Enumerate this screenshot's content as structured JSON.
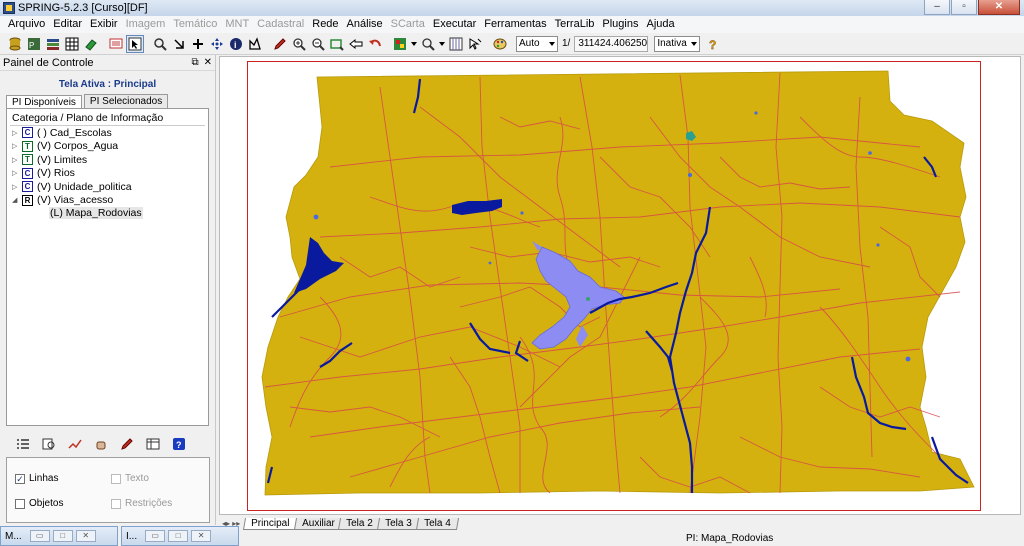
{
  "window": {
    "title": "SPRING-5.2.3 [Curso][DF]",
    "minimize": "–",
    "restore": "▫",
    "close": "✕"
  },
  "menu": [
    {
      "label": "Arquivo",
      "enabled": true
    },
    {
      "label": "Editar",
      "enabled": true
    },
    {
      "label": "Exibir",
      "enabled": true
    },
    {
      "label": "Imagem",
      "enabled": false
    },
    {
      "label": "Temático",
      "enabled": false
    },
    {
      "label": "MNT",
      "enabled": false
    },
    {
      "label": "Cadastral",
      "enabled": false
    },
    {
      "label": "Rede",
      "enabled": true
    },
    {
      "label": "Análise",
      "enabled": true
    },
    {
      "label": "SCarta",
      "enabled": false
    },
    {
      "label": "Executar",
      "enabled": true
    },
    {
      "label": "Ferramentas",
      "enabled": true
    },
    {
      "label": "TerraLib",
      "enabled": true
    },
    {
      "label": "Plugins",
      "enabled": true
    },
    {
      "label": "Ajuda",
      "enabled": true
    }
  ],
  "toolbar": {
    "scale_mode": "Auto",
    "scale_prefix": "1/",
    "scale_value": "311424.406250",
    "state": "Inativa"
  },
  "panel": {
    "title": "Painel de Controle",
    "active_screen": "Tela Ativa : Principal",
    "tabs": [
      "PI Disponíveis",
      "PI Selecionados"
    ],
    "tree_header": "Categoria / Plano de Informação",
    "tree": [
      {
        "icon": "C",
        "label": "( ) Cad_Escolas",
        "expanded": false
      },
      {
        "icon": "T",
        "label": "(V) Corpos_Agua",
        "expanded": false
      },
      {
        "icon": "T",
        "label": "(V) Limites",
        "expanded": false
      },
      {
        "icon": "C",
        "label": "(V) Rios",
        "expanded": false
      },
      {
        "icon": "C",
        "label": "(V) Unidade_politica",
        "expanded": false
      },
      {
        "icon": "R",
        "label": "(V) Vias_acesso",
        "expanded": true
      }
    ],
    "tree_child": "(L) Mapa_Rodovias",
    "checks": {
      "linhas": {
        "label": "Linhas",
        "checked": true
      },
      "texto": {
        "label": "Texto",
        "checked": false
      },
      "objetos": {
        "label": "Objetos",
        "checked": false
      },
      "restricoes": {
        "label": "Restrições",
        "checked": false
      }
    }
  },
  "mini_windows": [
    {
      "label": "M..."
    },
    {
      "label": "I..."
    }
  ],
  "screen_tabs": [
    "Principal",
    "Auxiliar",
    "Tela 2",
    "Tela 3",
    "Tela 4"
  ],
  "status": "PI: Mapa_Rodovias",
  "colors": {
    "land": "#d4b10f",
    "roads": "#d8484a",
    "rivers": "#0a1a9e",
    "lake": "#8c8cf2",
    "map_border": "#cc2222"
  }
}
